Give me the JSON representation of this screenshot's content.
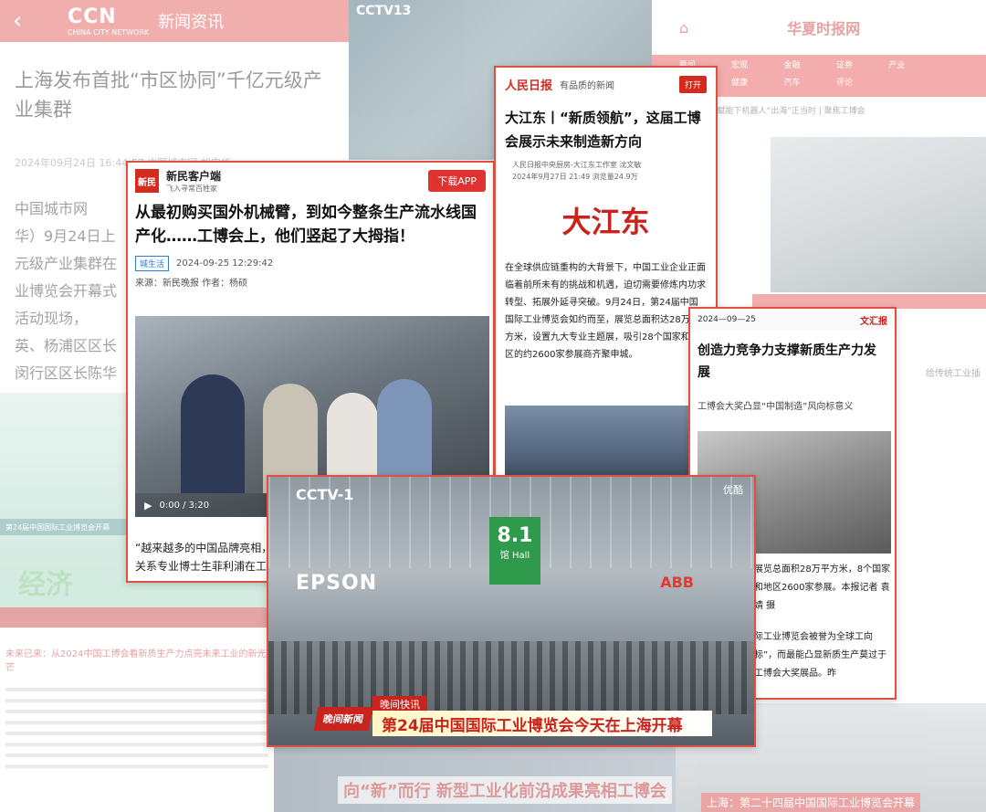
{
  "ccn": {
    "logo": "CCN",
    "logo_sub": "CHINA CITY NETWORK",
    "section": "新闻资讯",
    "title": "上海发布首批“市区协同”千亿元级产业集群",
    "meta": "2024年09月24日 16:44:57 中国城市网 胡安华",
    "body_lines": [
      "中国城市网",
      "华）9月24日上",
      "元级产业集群在",
      "业博览会开幕式",
      "活动现场，",
      "英、杨浦区区长",
      "闵行区区长陈华"
    ]
  },
  "cctv13": {
    "logo": "CCTV13"
  },
  "huaxia": {
    "logo": "华夏时报网",
    "nav": [
      "要闻",
      "宏观",
      "金融",
      "证券",
      "产业",
      "",
      "保险",
      "健康",
      "汽车",
      "评论"
    ],
    "ticker": "0万人参展，AI赋能下机器人“出海”正当时 | 聚焦工博会",
    "sidetext": "给传统工业插"
  },
  "green_panel": {
    "label": "第24届中国国际工业博览会开幕",
    "logo": "经济"
  },
  "paper": {
    "title": "未来已来：从2024中国工博会看新质生产力点亮未来工业的新光芒"
  },
  "bottom_strip": {
    "title": "向“新”而行 新型工业化前沿成果亮相工博会"
  },
  "bottom_strip2": {
    "title": "上海：第二十四届中国国际工业博览会开幕"
  },
  "xinmin": {
    "logo": "新民",
    "brand": "新民客户端",
    "brand_sub": "飞入寻常百姓家",
    "download": "下载APP",
    "title": "从最初购买国外机械臂，到如今整条生产流水线国产化……工博会上，他们竖起了大拇指！",
    "tag": "城生活",
    "datetime": "2024-09-25 12:29:42",
    "source": "来源：新民晚报   作者：杨硕",
    "video_time": "0:00 / 3:20",
    "quote": "“越来越多的中国品牌亮相，",
    "quote2": "关系专业博士生菲利浦在工"
  },
  "renmin": {
    "logo": "人民日报",
    "slogan": "有品质的新闻",
    "open": "打开",
    "title": "大江东丨“新质领航”，这届工博会展示未来制造新方向",
    "meta1": "人民日报中央厨房-大江东工作室 沈文敏",
    "meta2": "2024年9月27日 21:49  浏览量24.9万",
    "brand_logo": "大江东",
    "body": "在全球供应链重构的大背景下，中国工业企业正面临着前所未有的挑战和机遇，迫切需要修炼内功求转型、拓展外延寻突破。9月24日，第24届中国国际工业博览会如约而至，展览总面积达28万平方米，设置九大专业主题展，吸引28个国家和地区的约2600家参展商齐聚申城。"
  },
  "wenhui": {
    "date": "2024—09—25",
    "logo": "文汇报",
    "title": "创造力竞争力支撑新质生产力发展",
    "subtitle": "工博会大奖凸显“中国制造”风向标意义",
    "body": "展览总面积28万平方米，8个国家和地区2600家参展。本报记者 袁婧 摄",
    "body2": "际工业博览会被誉为全球工向标”，而最能凸显新质生产莫过于工博会大奖展品。昨"
  },
  "evening_news": {
    "cctv_logo": "CCTV-1",
    "youku": "优酷",
    "hall_number": "8.1",
    "hall_label": "馆 Hall",
    "epson": "EPSON",
    "abb": "ABB",
    "caption_small": "晚间快讯",
    "caption_logo": "晚间新闻",
    "caption_main": "第24届中国国际工业博览会今天在上海开幕"
  }
}
